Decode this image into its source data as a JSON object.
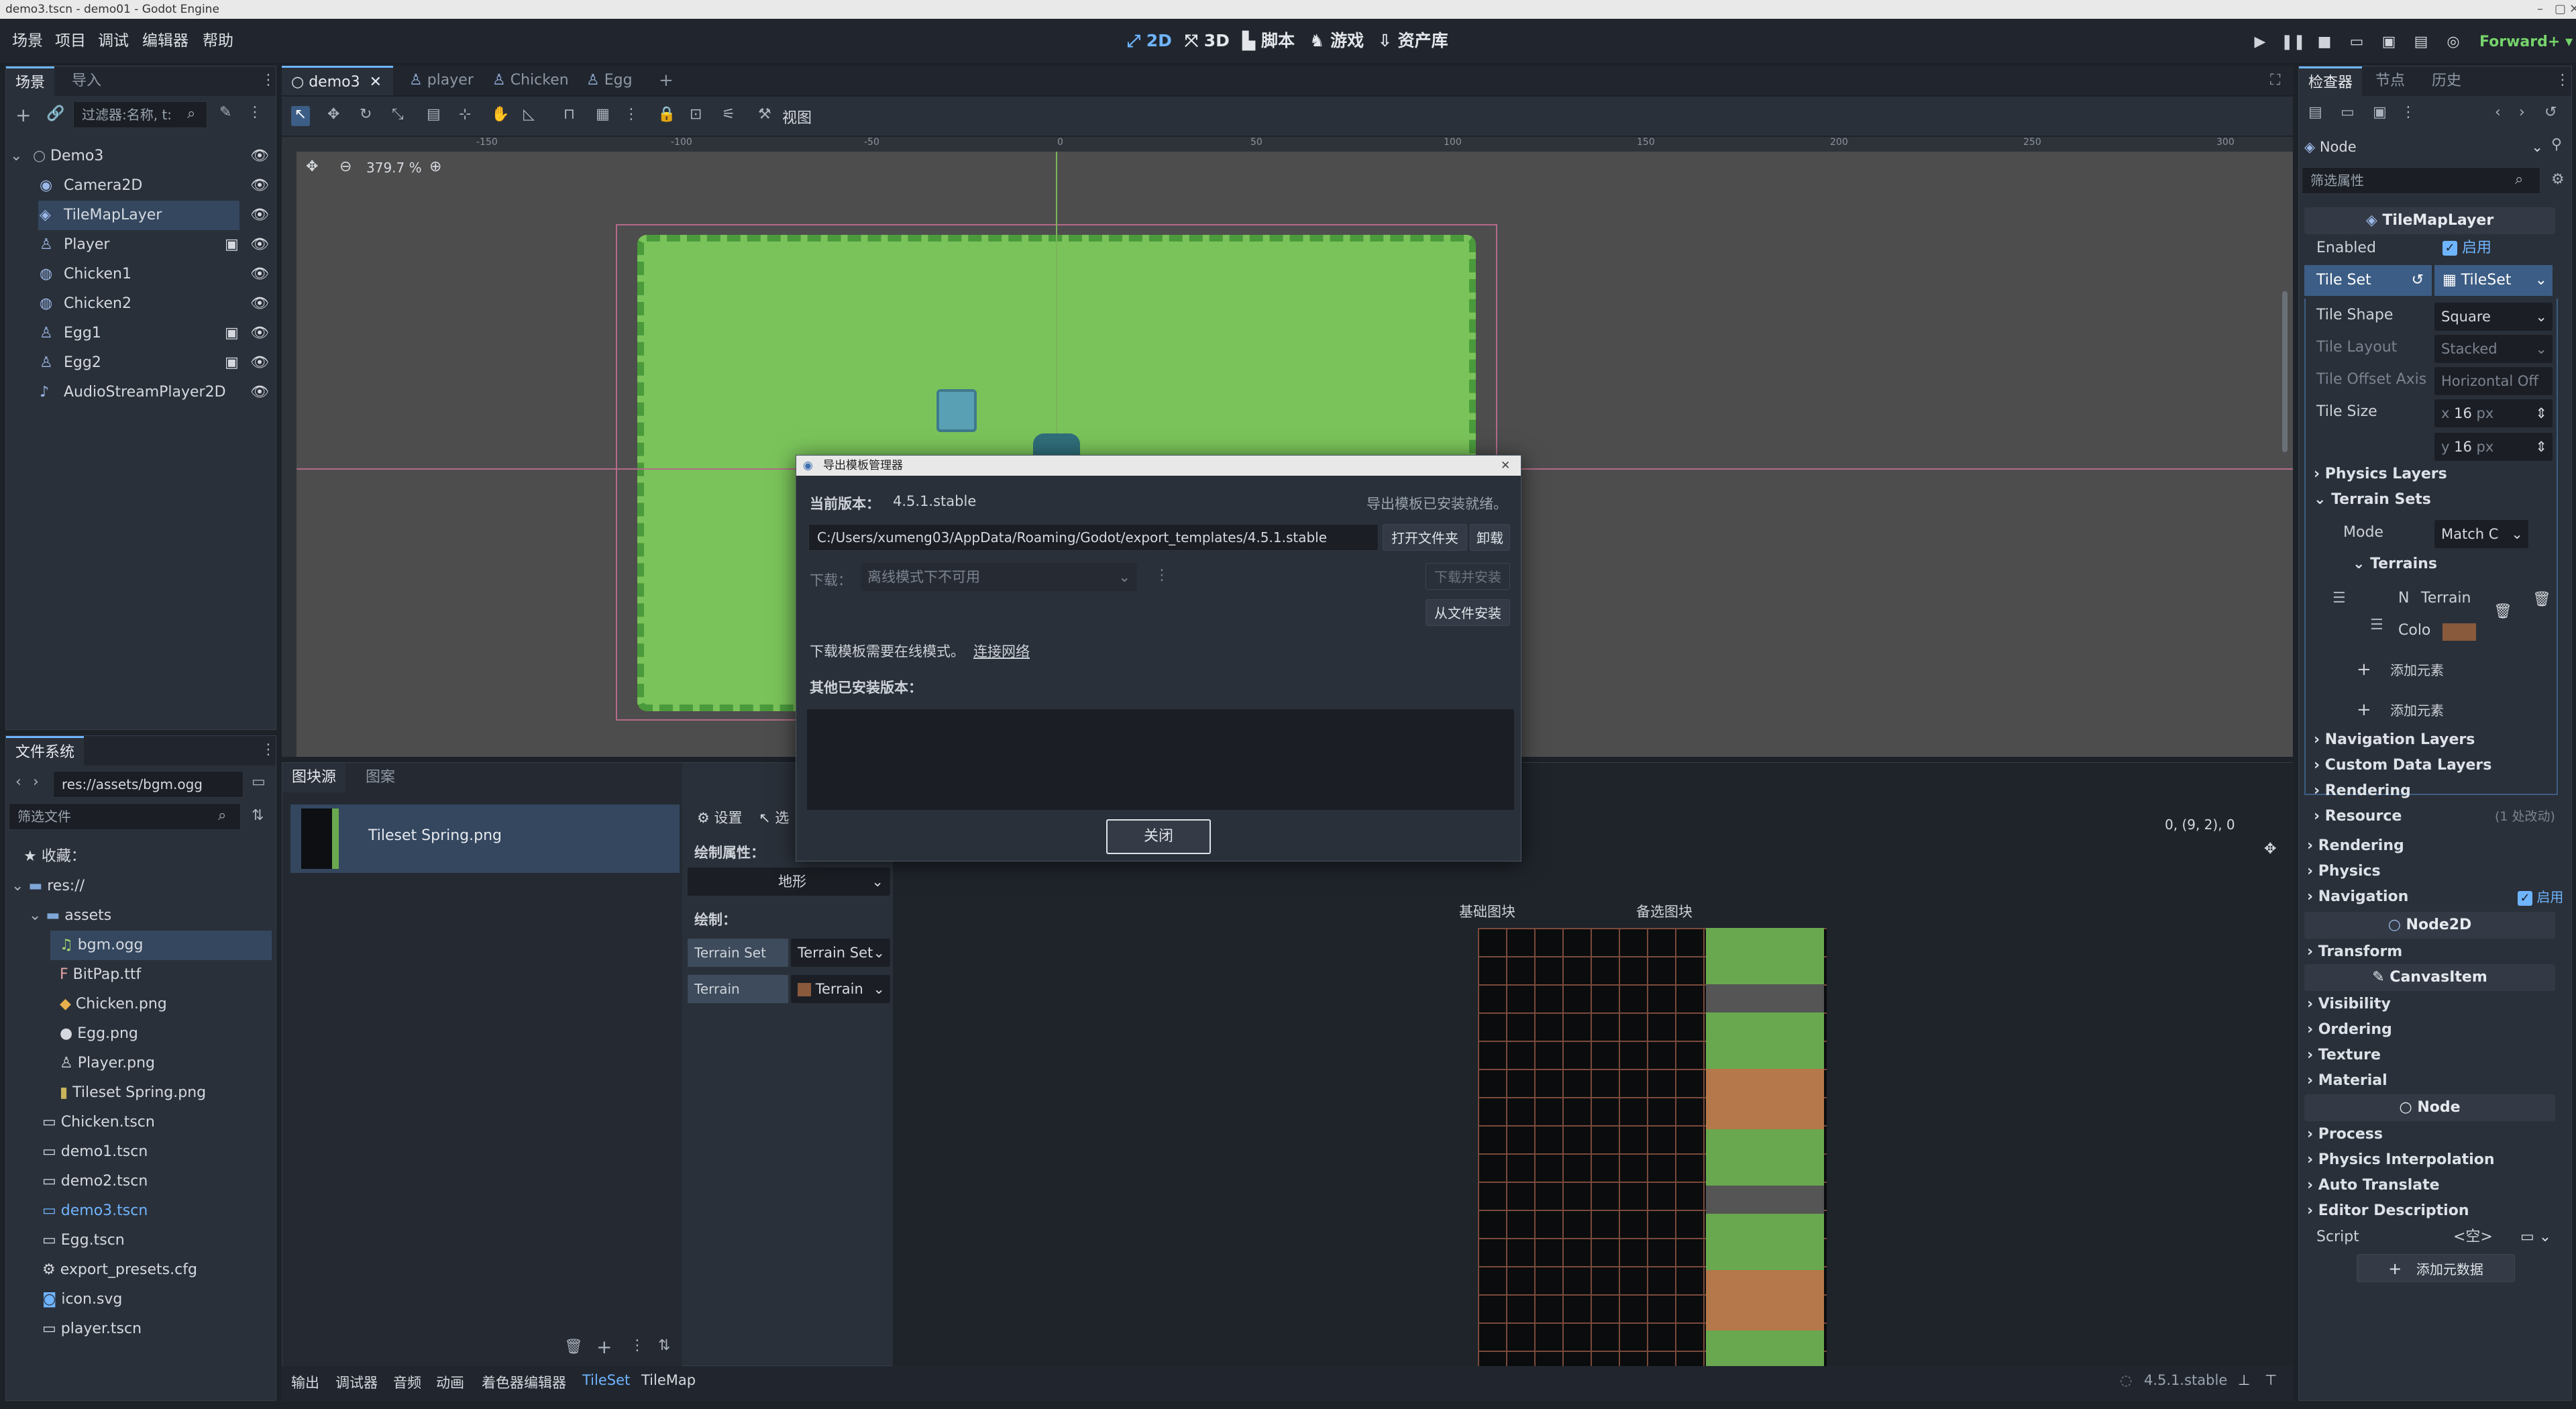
{
  "window": {
    "title": "demo3.tscn - demo01 - Godot Engine"
  },
  "menu": {
    "items": [
      "场景",
      "项目",
      "调试",
      "编辑器",
      "帮助"
    ],
    "modes": [
      "2D",
      "3D",
      "脚本",
      "游戏",
      "资产库"
    ],
    "renderer": "Forward+"
  },
  "scene_panel": {
    "tabs": [
      "场景",
      "导入"
    ],
    "filter_placeholder": "过滤器:名称, t:",
    "tree": [
      "Demo3",
      "Camera2D",
      "TileMapLayer",
      "Player",
      "Chicken1",
      "Chicken2",
      "Egg1",
      "Egg2",
      "AudioStreamPlayer2D"
    ],
    "selected": "TileMapLayer"
  },
  "filesystem": {
    "title": "文件系统",
    "path": "res://assets/bgm.ogg",
    "filter_placeholder": "筛选文件",
    "favorites": "收藏：",
    "items": [
      "res://",
      "assets",
      "bgm.ogg",
      "BitPap.ttf",
      "Chicken.png",
      "Egg.png",
      "Player.png",
      "Tileset Spring.png",
      "Chicken.tscn",
      "demo1.tscn",
      "demo2.tscn",
      "demo3.tscn",
      "Egg.tscn",
      "export_presets.cfg",
      "icon.svg",
      "player.tscn"
    ],
    "selected": "bgm.ogg"
  },
  "editor_tabs": [
    "demo3",
    "player",
    "Chicken",
    "Egg"
  ],
  "toolbar": {
    "view": "视图"
  },
  "viewport": {
    "zoom": "379.7 %",
    "ruler_marks": [
      "-150",
      "-100",
      "-50",
      "0",
      "50",
      "100",
      "150",
      "200",
      "250",
      "300"
    ]
  },
  "dialog": {
    "title": "导出模板管理器",
    "current_version_label": "当前版本：",
    "current_version": "4.5.1.stable",
    "status": "导出模板已安装就绪。",
    "path": "C:/Users/xumeng03/AppData/Roaming/Godot/export_templates/4.5.1.stable",
    "open_folder": "打开文件夹",
    "uninstall": "卸载",
    "download_label": "下载：",
    "download_select": "离线模式下不可用",
    "download_install": "下载并安装",
    "install_from_file": "从文件安装",
    "online_note": "下载模板需要在线模式。",
    "connect": "连接网络",
    "other_versions": "其他已安装版本：",
    "close": "关闭"
  },
  "tileset_panel": {
    "tabs": [
      "图块源",
      "图案"
    ],
    "source": "Tileset Spring.png",
    "tools": [
      "设置",
      "选"
    ],
    "paint_props": "绘制属性：",
    "terrain_mode": "地形",
    "paint": "绘制：",
    "terrain_set_label": "Terrain Set",
    "terrain_set_value": "Terrain Set",
    "terrain_label": "Terrain",
    "terrain_value": "Terrain",
    "coords": "0, (9, 2), 0",
    "base_tiles": "基础图块",
    "alt_tiles": "备选图块"
  },
  "bottom_bar": {
    "items": [
      "输出",
      "调试器",
      "音频",
      "动画",
      "着色器编辑器",
      "TileSet",
      "TileMap"
    ],
    "active": "TileSet",
    "version": "4.5.1.stable"
  },
  "inspector": {
    "tabs": [
      "检查器",
      "节点",
      "历史"
    ],
    "node": "Node",
    "filter_placeholder": "筛选属性",
    "class_header": "TileMapLayer",
    "enabled_label": "Enabled",
    "enabled_value": "启用",
    "tileset_label": "Tile Set",
    "tileset_value": "TileSet",
    "props": [
      {
        "k": "Tile Shape",
        "v": "Square"
      },
      {
        "k": "Tile Layout",
        "v": "Stacked"
      },
      {
        "k": "Tile Offset Axis",
        "v": "Horizontal Off"
      },
      {
        "k": "Tile Size",
        "v": "16"
      }
    ],
    "tile_size_x": "16",
    "tile_size_y": "16",
    "unit": "px",
    "physics_layers": "Physics Layers",
    "terrain_sets": "Terrain Sets",
    "mode_label": "Mode",
    "mode_value": "Match C",
    "terrains": "Terrains",
    "terrain_name": "Terrain",
    "terrain_n": "N",
    "color_label": "Colo",
    "add_element": "添加元素",
    "terrain_color": "#8a5a3c",
    "sections1": [
      "Navigation Layers",
      "Custom Data Layers",
      "Rendering",
      "Resource"
    ],
    "resource_note": "(1 处改动)",
    "sections2": [
      "Rendering",
      "Physics",
      "Navigation"
    ],
    "nav_enabled": "启用",
    "node2d": "Node2D",
    "sections3": [
      "Transform"
    ],
    "canvasitem": "CanvasItem",
    "sections4": [
      "Visibility",
      "Ordering",
      "Texture",
      "Material"
    ],
    "sections5": [
      "Process",
      "Physics Interpolation",
      "Auto Translate",
      "Editor Description"
    ],
    "script_label": "Script",
    "script_value": "<空>",
    "add_metadata": "添加元数据"
  }
}
